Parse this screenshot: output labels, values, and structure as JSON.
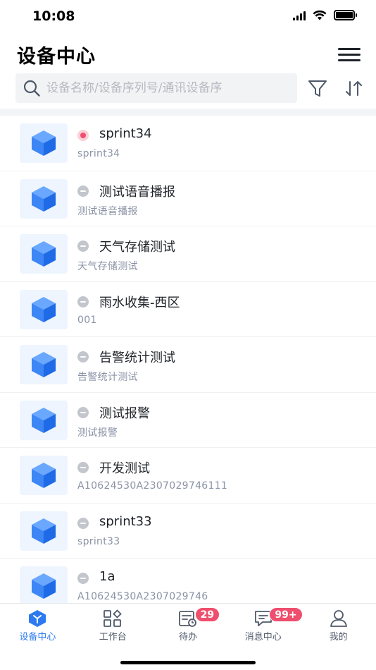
{
  "status_bar": {
    "time": "10:08"
  },
  "header": {
    "title": "设备中心"
  },
  "search": {
    "placeholder": "设备名称/设备序列号/通讯设备序"
  },
  "devices": [
    {
      "name": "sprint34",
      "sub": "sprint34",
      "status": "online"
    },
    {
      "name": "测试语音播报",
      "sub": "测试语音播报",
      "status": "offline"
    },
    {
      "name": "天气存储测试",
      "sub": "天气存储测试",
      "status": "offline"
    },
    {
      "name": "雨水收集-西区",
      "sub": "001",
      "status": "offline"
    },
    {
      "name": "告警统计测试",
      "sub": "告警统计测试",
      "status": "offline"
    },
    {
      "name": "测试报警",
      "sub": "测试报警",
      "status": "offline"
    },
    {
      "name": "开发测试",
      "sub": "A10624530A2307029746111",
      "status": "offline"
    },
    {
      "name": "sprint33",
      "sub": "sprint33",
      "status": "offline"
    },
    {
      "name": "1a",
      "sub": "A10624530A2307029746",
      "status": "offline"
    }
  ],
  "tabs": [
    {
      "label": "设备中心",
      "icon": "device-center-icon",
      "active": true
    },
    {
      "label": "工作台",
      "icon": "workbench-icon"
    },
    {
      "label": "待办",
      "icon": "todo-icon",
      "badge": "29"
    },
    {
      "label": "消息中心",
      "icon": "message-icon",
      "badge": "99+"
    },
    {
      "label": "我的",
      "icon": "profile-icon"
    }
  ],
  "colors": {
    "accent": "#2d7af0",
    "online": "#ef4f6e",
    "offline": "#c3c6cc",
    "badge": "#ef4f6e"
  }
}
